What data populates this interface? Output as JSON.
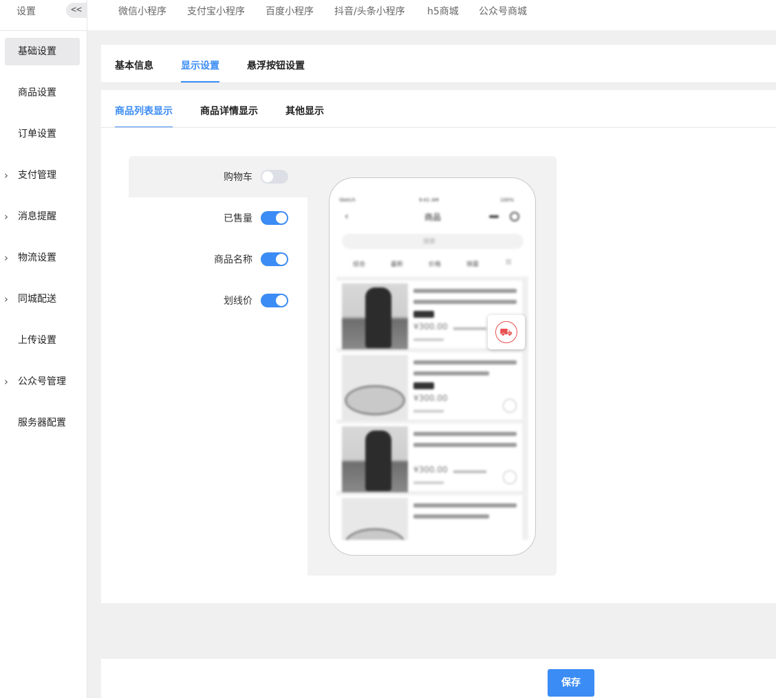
{
  "sidebar": {
    "title": "设置",
    "collapse_label": "<<",
    "items": [
      {
        "label": "基础设置",
        "arrow": "",
        "active": true
      },
      {
        "label": "商品设置",
        "arrow": ""
      },
      {
        "label": "订单设置",
        "arrow": ""
      },
      {
        "label": "支付管理",
        "arrow": "›"
      },
      {
        "label": "消息提醒",
        "arrow": "›"
      },
      {
        "label": "物流设置",
        "arrow": "›"
      },
      {
        "label": "同城配送",
        "arrow": "›"
      },
      {
        "label": "上传设置",
        "arrow": ""
      },
      {
        "label": "公众号管理",
        "arrow": "›"
      },
      {
        "label": "服务器配置",
        "arrow": ""
      }
    ]
  },
  "top_tabs": [
    "微信小程序",
    "支付宝小程序",
    "百度小程序",
    "抖音/头条小程序",
    "h5商城",
    "公众号商城"
  ],
  "main_tabs": {
    "items": [
      "基本信息",
      "显示设置",
      "悬浮按钮设置"
    ],
    "active": "显示设置"
  },
  "sub_tabs": {
    "items": [
      "商品列表显示",
      "商品详情显示",
      "其他显示"
    ],
    "active": "商品列表显示"
  },
  "settings": [
    {
      "label": "购物车",
      "enabled": false
    },
    {
      "label": "已售量",
      "enabled": true
    },
    {
      "label": "商品名称",
      "enabled": true
    },
    {
      "label": "划线价",
      "enabled": true
    }
  ],
  "preview": {
    "status_left": "Sketch",
    "status_time": "9:41 AM",
    "status_right": "100%",
    "title": "商品",
    "search_placeholder": "搜索",
    "sort": [
      "综合",
      "最新",
      "价格",
      "销量"
    ],
    "prices": [
      "¥300.00",
      "¥300.00",
      "¥300.00"
    ]
  },
  "footer": {
    "save_label": "保存"
  },
  "colors": {
    "accent": "#3b8cf4",
    "cart": "#e84e4e"
  }
}
